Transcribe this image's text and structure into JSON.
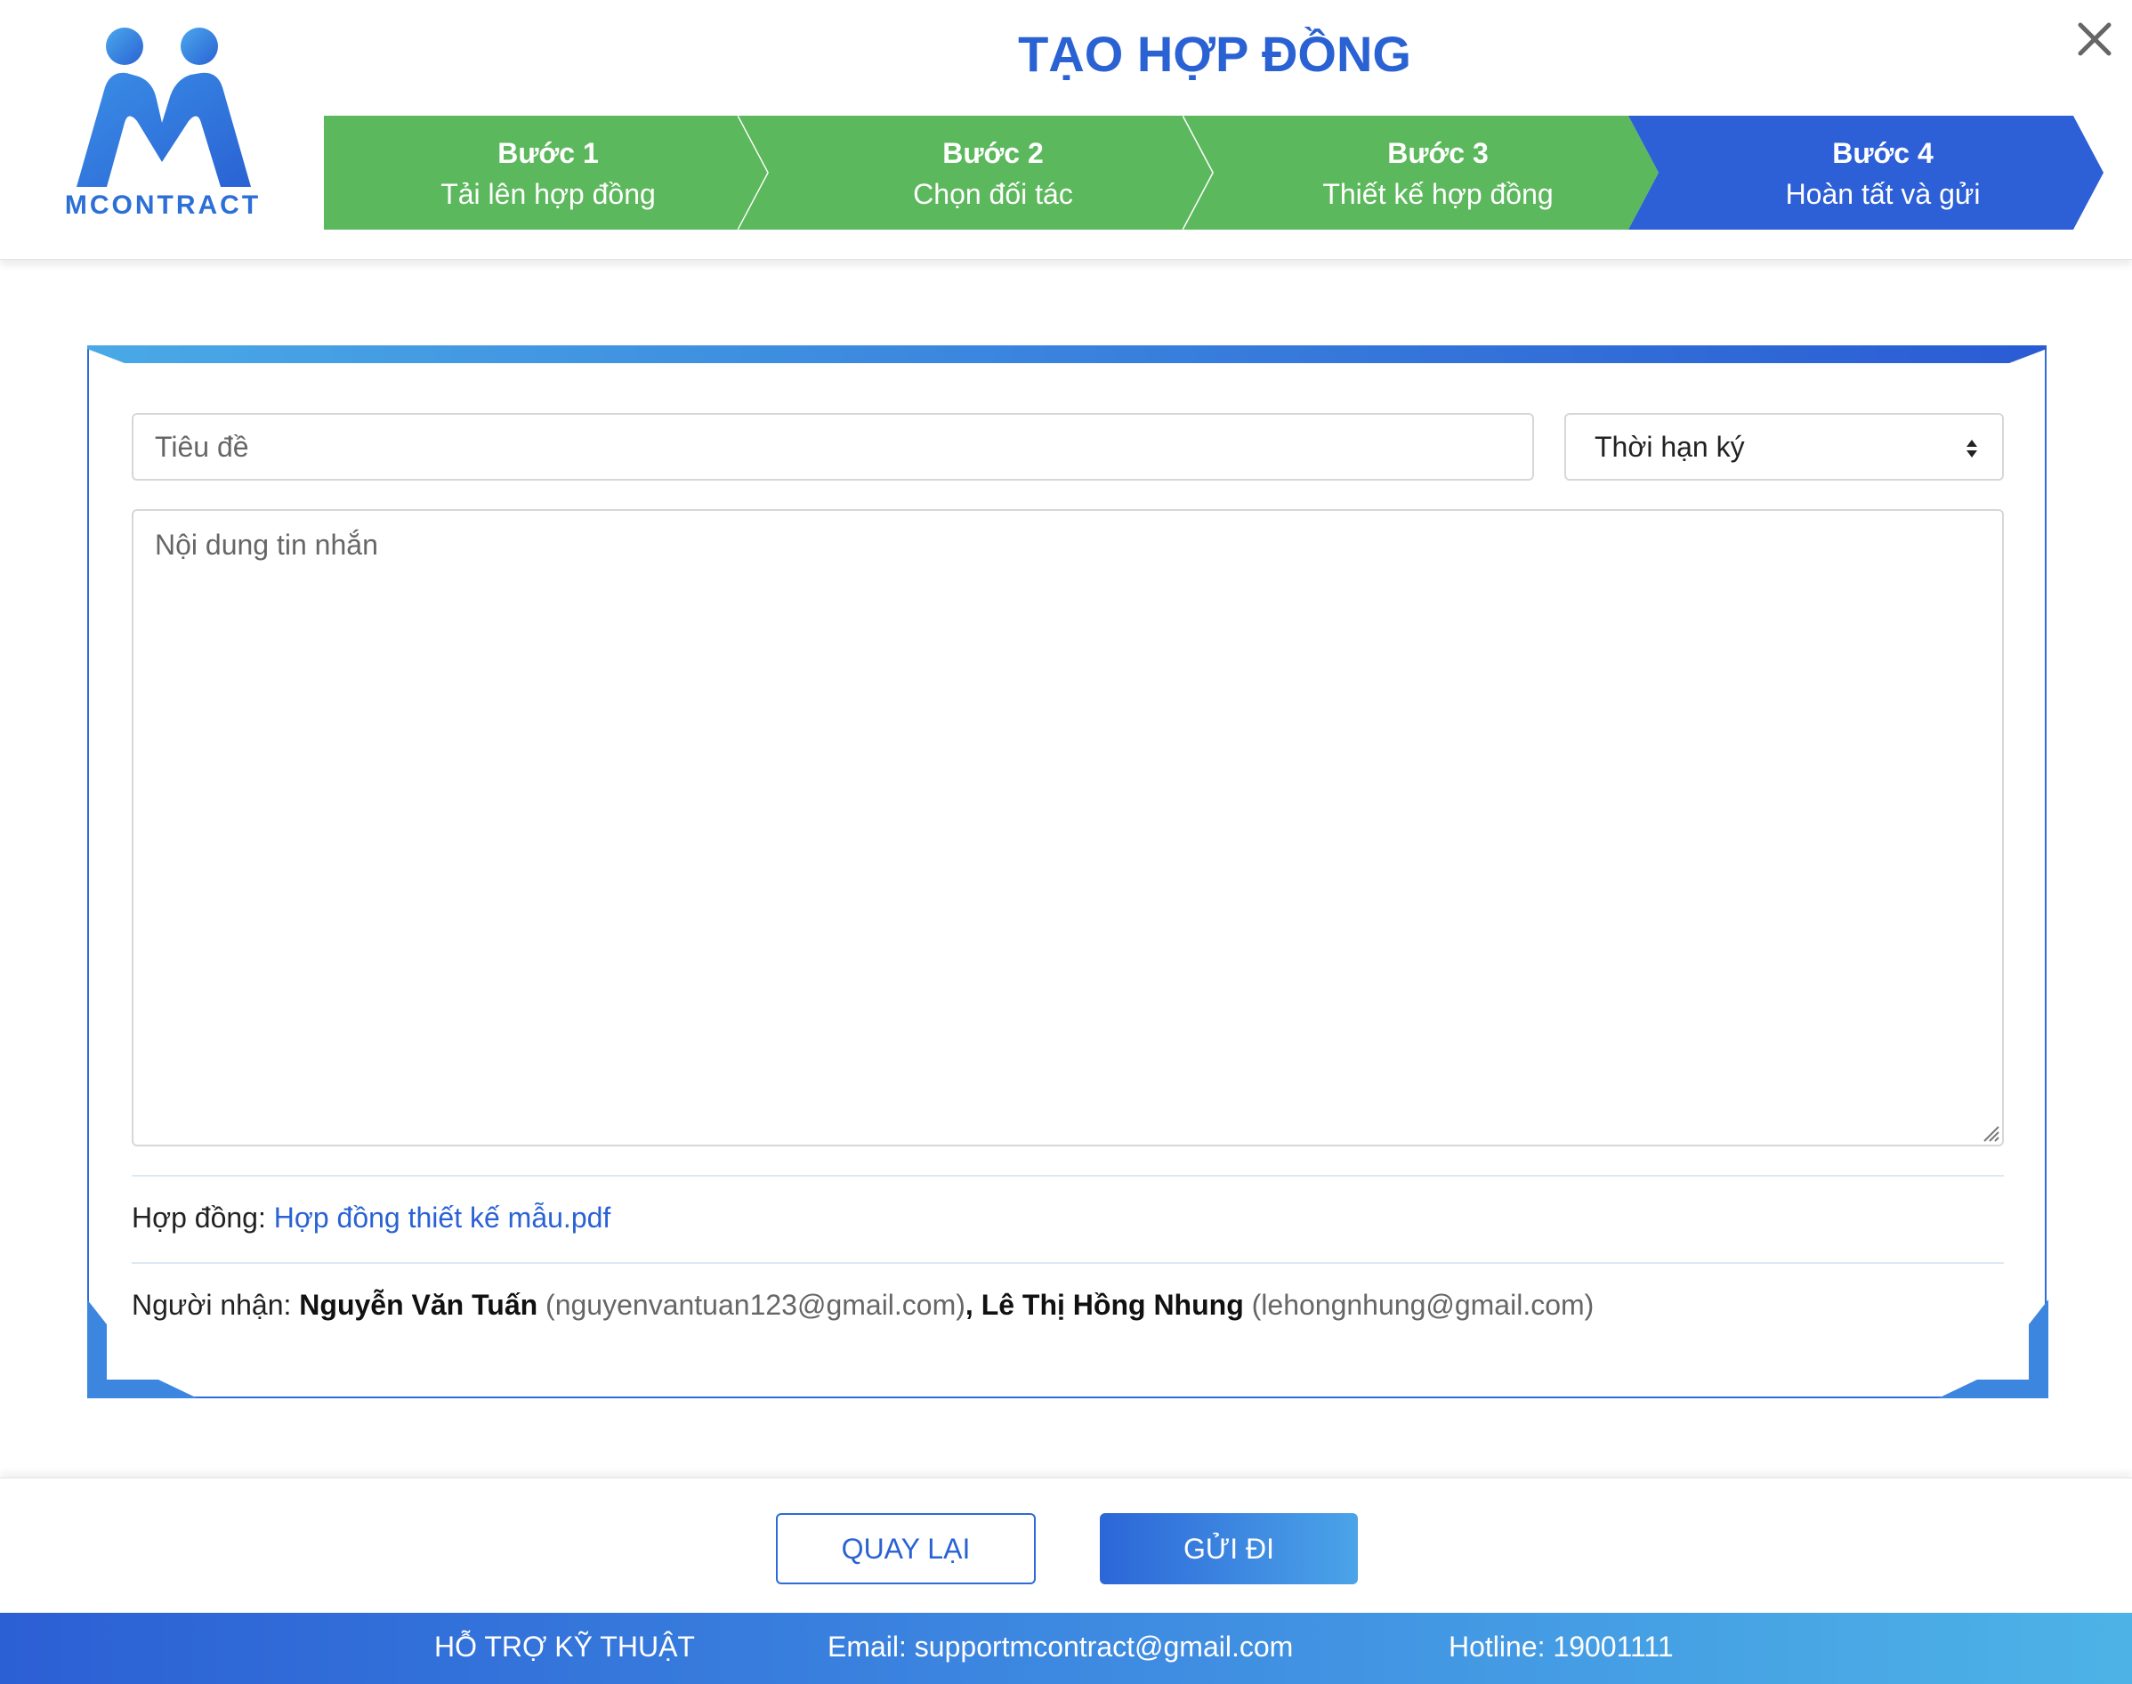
{
  "header": {
    "logo_text": "MCONTRACT",
    "title": "TẠO HỢP ĐỒNG",
    "close_label": "×"
  },
  "steps": [
    {
      "number": "Bước 1",
      "label": "Tải lên hợp đồng",
      "state": "done",
      "color": "#5cb85c"
    },
    {
      "number": "Bước 2",
      "label": "Chọn đối tác",
      "state": "done",
      "color": "#5cb85c"
    },
    {
      "number": "Bước 3",
      "label": "Thiết kế hợp đồng",
      "state": "done",
      "color": "#5cb85c"
    },
    {
      "number": "Bước 4",
      "label": "Hoàn tất và gửi",
      "state": "active",
      "color": "#2d5fd6"
    }
  ],
  "form": {
    "title_placeholder": "Tiêu đề",
    "title_value": "",
    "deadline_selected": "Thời hạn ký",
    "message_placeholder": "Nội dung tin nhắn",
    "message_value": ""
  },
  "contract": {
    "label": "Hợp đồng: ",
    "file_name": "Hợp đồng thiết kế mẫu.pdf"
  },
  "recipients": {
    "label": "Người nhận: ",
    "list": [
      {
        "name": "Nguyễn Văn Tuấn",
        "email": "(nguyenvantuan123@gmail.com)",
        "separator": ", "
      },
      {
        "name": "Lê Thị Hồng Nhung",
        "email": "(lehongnhung@gmail.com)",
        "separator": ""
      }
    ]
  },
  "actions": {
    "back_label": "QUAY LẠI",
    "send_label": "GỬI ĐI"
  },
  "support": {
    "title": "HỖ TRỢ KỸ THUẬT",
    "email": "Email: supportmcontract@gmail.com",
    "hotline": "Hotline: 19001111"
  },
  "colors": {
    "accent_blue": "#2a62d4",
    "step_green": "#5cb85c",
    "step_blue": "#2d5fd6"
  }
}
